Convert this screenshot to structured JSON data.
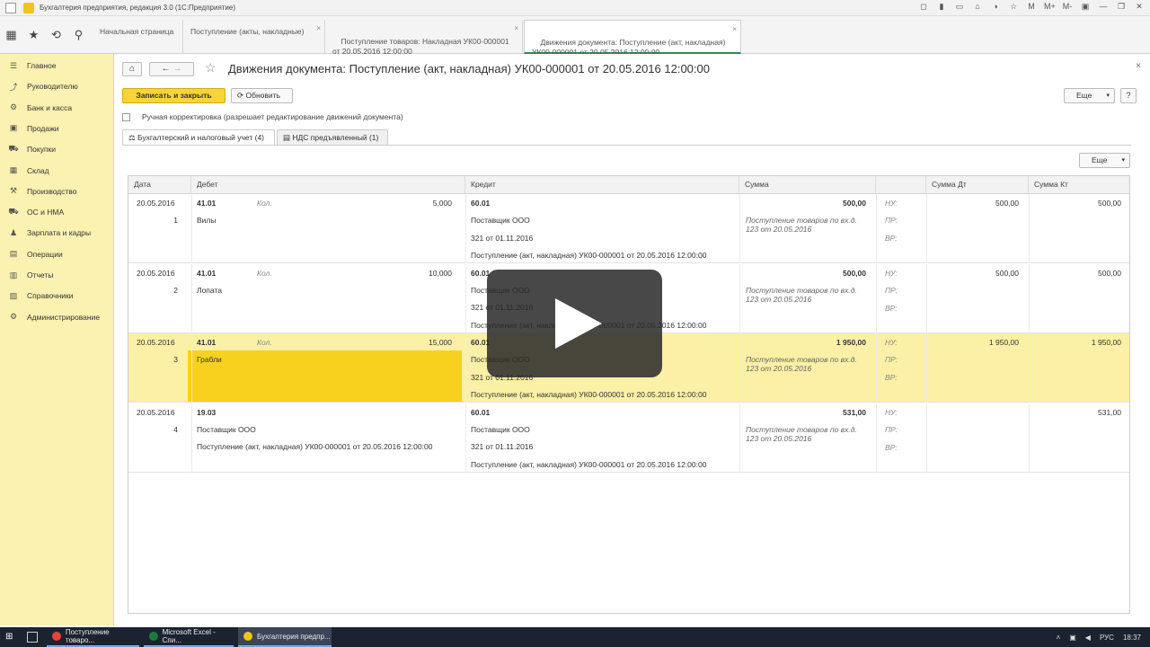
{
  "window": {
    "title": "Бухгалтерия предприятия, редакция 3.0  (1С:Предприятие)",
    "controls": [
      "◻",
      "▮",
      "▭",
      "⌂",
      "◑",
      "☆",
      "M",
      "M+",
      "M-",
      "▣",
      "—",
      "❐",
      "✕"
    ]
  },
  "tabs": [
    {
      "label": "Начальная страница",
      "closable": false
    },
    {
      "label": "Поступление (акты, накладные)",
      "closable": true
    },
    {
      "label": "Поступление товаров: Накладная УК00-000001\nот 20.05.2016 12:00:00",
      "closable": true
    },
    {
      "label": "Движения документа: Поступление (акт, накладная)\nУК00-000001 от 20.05.2016 12:00:00",
      "closable": true
    }
  ],
  "sidebar": {
    "items": [
      {
        "label": "Главное",
        "icon": "☰"
      },
      {
        "label": "Руководителю",
        "icon": "⤴"
      },
      {
        "label": "Банк и касса",
        "icon": "⚙"
      },
      {
        "label": "Продажи",
        "icon": "▣"
      },
      {
        "label": "Покупки",
        "icon": "⛟"
      },
      {
        "label": "Склад",
        "icon": "▦"
      },
      {
        "label": "Производство",
        "icon": "⚒"
      },
      {
        "label": "ОС и НМА",
        "icon": "⛟"
      },
      {
        "label": "Зарплата и кадры",
        "icon": "♟"
      },
      {
        "label": "Операции",
        "icon": "▤"
      },
      {
        "label": "Отчеты",
        "icon": "▥"
      },
      {
        "label": "Справочники",
        "icon": "▧"
      },
      {
        "label": "Администрирование",
        "icon": "⚙"
      }
    ]
  },
  "document": {
    "title": "Движения документа: Поступление (акт, накладная) УК00-000001 от 20.05.2016 12:00:00",
    "save_close_label": "Записать и закрыть",
    "refresh_label": "Обновить",
    "more_label": "Еще",
    "help_label": "?",
    "manual_correction_label": "Ручная корректировка (разрешает редактирование движений документа)",
    "subtabs": [
      "Бухгалтерский и налоговый учет (4)",
      "НДС предъявленный (1)"
    ]
  },
  "table": {
    "more_label": "Еще",
    "headers": [
      "Дата",
      "Дебет",
      "Кредит",
      "Сумма",
      "",
      "Сумма Дт",
      "Сумма Кт"
    ],
    "rows": [
      {
        "date": "20.05.2016",
        "num": "1",
        "debit_acc": "41.01",
        "debit_qty_label": "Кол.",
        "debit_qty": "5,000",
        "debit_sub": [
          "Вилы",
          "",
          ""
        ],
        "credit_acc": "60.01",
        "credit_sub": [
          "Поставщик ООО",
          "321 от 01.11.2016",
          "Поступление (акт, накладная) УК00-000001 от 20.05.2016 12:00:00"
        ],
        "sum": "500,00",
        "desc": "Поступление товаров по вх.д. 123 от 20.05.2016",
        "nu": "НУ:",
        "pr": "ПР:",
        "vr": "ВР:",
        "sum_dt": "500,00",
        "sum_kt": "500,00",
        "selected": false
      },
      {
        "date": "20.05.2016",
        "num": "2",
        "debit_acc": "41.01",
        "debit_qty_label": "Кол.",
        "debit_qty": "10,000",
        "debit_sub": [
          "Лопата",
          "",
          ""
        ],
        "credit_acc": "60.01",
        "credit_sub": [
          "Поставщик ООО",
          "321 от 01.11.2016",
          "Поступление (акт, накладная) УК00-000001 от 20.05.2016 12:00:00"
        ],
        "sum": "500,00",
        "desc": "Поступление товаров по вх.д. 123 от 20.05.2016",
        "nu": "НУ:",
        "pr": "ПР:",
        "vr": "ВР:",
        "sum_dt": "500,00",
        "sum_kt": "500,00",
        "selected": false
      },
      {
        "date": "20.05.2016",
        "num": "3",
        "debit_acc": "41.01",
        "debit_qty_label": "Кол.",
        "debit_qty": "15,000",
        "debit_sub": [
          "Грабли",
          "",
          ""
        ],
        "credit_acc": "60.01",
        "credit_sub": [
          "Поставщик ООО",
          "321 от 01.11.2016",
          "Поступление (акт, накладная) УК00-000001 от 20.05.2016 12:00:00"
        ],
        "sum": "1 950,00",
        "desc": "Поступление товаров по вх.д. 123 от 20.05.2016",
        "nu": "НУ:",
        "pr": "ПР:",
        "vr": "ВР:",
        "sum_dt": "1 950,00",
        "sum_kt": "1 950,00",
        "selected": true
      },
      {
        "date": "20.05.2016",
        "num": "4",
        "debit_acc": "19.03",
        "debit_qty_label": "",
        "debit_qty": "",
        "debit_sub": [
          "Поставщик ООО",
          "Поступление (акт, накладная) УК00-000001 от 20.05.2016 12:00:00",
          ""
        ],
        "credit_acc": "60.01",
        "credit_sub": [
          "Поставщик ООО",
          "321 от 01.11.2016",
          "Поступление (акт, накладная) УК00-000001 от 20.05.2016 12:00:00"
        ],
        "sum": "531,00",
        "desc": "Поступление товаров по вх.д. 123 от 20.05.2016",
        "nu": "НУ:",
        "pr": "ПР:",
        "vr": "ВР:",
        "sum_dt": "",
        "sum_kt": "531,00",
        "selected": false
      }
    ]
  },
  "taskbar": {
    "tasks": [
      {
        "label": "Поступление товаро...",
        "color": "#e0443a"
      },
      {
        "label": "Microsoft Excel - Спи...",
        "color": "#1e7a3c"
      },
      {
        "label": "Бухгалтерия предпр...",
        "color": "#f0c419"
      }
    ],
    "lang": "РУС",
    "time": "18:37"
  }
}
